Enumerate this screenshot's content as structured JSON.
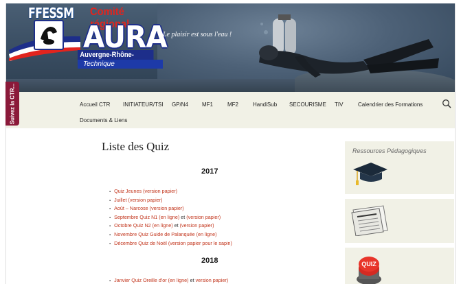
{
  "header": {
    "logo_ffessm": "FFESSM",
    "logo_comite": "Comité régional",
    "logo_aura": "AURA",
    "logo_region": "Auvergne-Rhône-Alpes",
    "logo_technique": "Technique",
    "tagline": "Le plaisir est sous l'eau !"
  },
  "side_tab": {
    "label": "Suivez la CTR..."
  },
  "nav": {
    "items": [
      "Accueil CTR",
      "INITIATEUR/TSI",
      "GP/N4",
      "MF1",
      "MF2",
      "HandiSub",
      "SECOURISME",
      "TIV",
      "Calendrier des Formations",
      "Documents & Liens"
    ]
  },
  "main": {
    "title": "Liste des Quiz",
    "sections": [
      {
        "year": "2017",
        "items": [
          {
            "link": "Quiz Jeunes (version papier)"
          },
          {
            "link": "Juillet (version papier)"
          },
          {
            "link": "Août – Narcose (version papier)"
          },
          {
            "link": "Septembre Quiz N1 (en ligne)",
            "joiner": " et ",
            "link2": "(version papier)"
          },
          {
            "link": "Octobre Quiz N2 (en ligne)",
            "joiner": " et ",
            "link2": "(version papier)"
          },
          {
            "link": "Novembre Quiz  Guide de Palanquée (en ligne)"
          },
          {
            "link": "Décembre Quiz de Noël (version papier pour le sapin)"
          }
        ]
      },
      {
        "year": "2018",
        "items": [
          {
            "link": "Janvier Quiz Oreille d'or (en ligne)",
            "joiner": " et ",
            "link2": "version papier)"
          }
        ]
      }
    ]
  },
  "sidebar": {
    "widget1_title": "Ressources Pédagogiques",
    "widget3_label": "QUIZ"
  },
  "colors": {
    "accent_link": "#c2341b",
    "nav_bg": "#f1f1e6",
    "side_tab": "#8b1a3a",
    "brand_blue": "#1d2e8a",
    "brand_red": "#e2241e"
  }
}
